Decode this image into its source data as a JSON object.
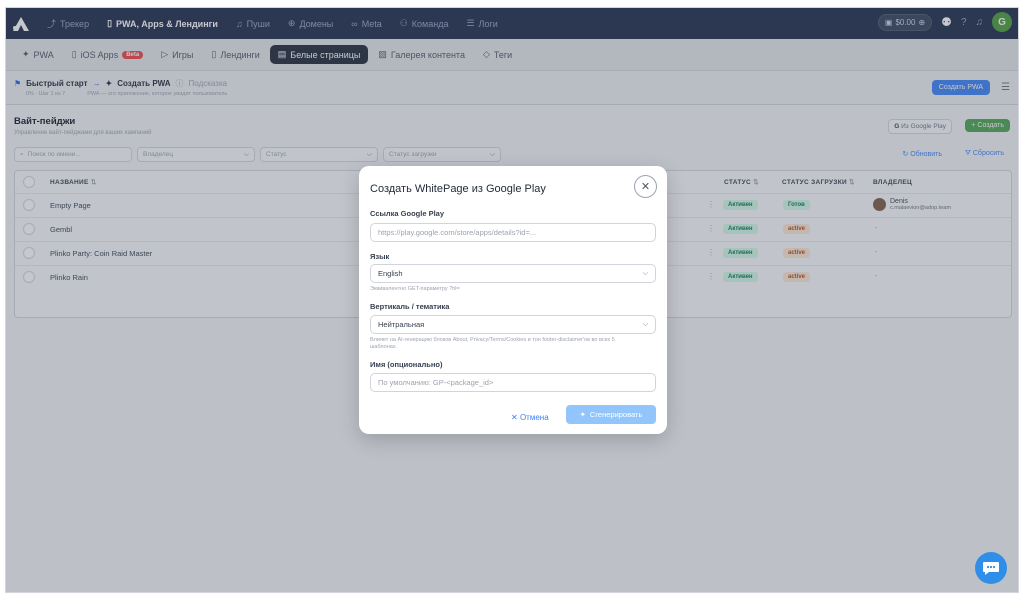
{
  "topnav": [
    {
      "icon": "⤴",
      "label": "Трекер",
      "active": false
    },
    {
      "icon": "▯",
      "label": "PWA, Apps & Лендинги",
      "active": true
    },
    {
      "icon": "♫",
      "label": "Пуши",
      "active": false
    },
    {
      "icon": "⊕",
      "label": "Домены",
      "active": false
    },
    {
      "icon": "∞",
      "label": "Meta",
      "active": false
    },
    {
      "icon": "⚇",
      "label": "Команда",
      "active": false
    },
    {
      "icon": "☰",
      "label": "Логи",
      "active": false
    }
  ],
  "top_right": {
    "balance": "$0.00",
    "avatar_letter": "G"
  },
  "subnav": [
    {
      "icon": "✦",
      "label": "PWA",
      "active": false
    },
    {
      "icon": "▯",
      "label": "iOS Apps",
      "badge": "Beta",
      "active": false
    },
    {
      "icon": "▷",
      "label": "Игры",
      "active": false
    },
    {
      "icon": "▯",
      "label": "Лендинги",
      "active": false
    },
    {
      "icon": "▤",
      "label": "Белые страницы",
      "active": true
    },
    {
      "icon": "▧",
      "label": "Галерея контента",
      "active": false
    },
    {
      "icon": "◇",
      "label": "Теги",
      "active": false
    }
  ],
  "quickstart": {
    "title": "Быстрый старт",
    "step": "Создать PWA",
    "hint": "Подсказка",
    "progress": "0% · Шаг 1 из 7",
    "desc": "PWA — это приложение, которое увидит пользователь",
    "create_pwa_button": "Создать PWA"
  },
  "page": {
    "title": "Вайт-пейджи",
    "subtitle": "Управление вайт-пейджами для ваших кампаний",
    "from_google_play": "Из Google Play",
    "create": "+ Создать",
    "refresh": "Обновить",
    "reset": "Сбросить"
  },
  "filters": {
    "search": "Поиск по имени...",
    "owner": "Владелец",
    "status": "Статус",
    "load_status": "Статус загрузки"
  },
  "table": {
    "headers": {
      "name": "НАЗВАНИЕ",
      "status": "СТАТУС",
      "load_status": "СТАТУС ЗАГРУЗКИ",
      "owner": "ВЛАДЕЛЕЦ"
    },
    "rows": [
      {
        "name": "Empty Page",
        "status": "Активен",
        "load_status": "Готов",
        "load_kind": "ready",
        "owner_name": "Denis",
        "owner_email": "c.malaevion@adop.team"
      },
      {
        "name": "Gembl",
        "status": "Активен",
        "load_status": "active",
        "load_kind": "warn",
        "owner_name": "-"
      },
      {
        "name": "Plinko Party: Coin Raid Master",
        "status": "Активен",
        "load_status": "active",
        "load_kind": "warn",
        "owner_name": "-"
      },
      {
        "name": "Plinko Rain",
        "status": "Активен",
        "load_status": "active",
        "load_kind": "warn",
        "owner_name": "-"
      }
    ]
  },
  "modal": {
    "title": "Создать WhitePage из Google Play",
    "gp_link_label": "Ссылка Google Play",
    "gp_link_placeholder": "https://play.google.com/store/apps/details?id=...",
    "lang_label": "Язык",
    "lang_value": "English",
    "lang_help": "Эквивалентно GET-параметру ?hl=",
    "vertical_label": "Вертикаль / тематика",
    "vertical_value": "Нейтральная",
    "vertical_help": "Влияет на AI-генерацию блоков About, Privacy/Terms/Cookies и тон footer-disclaimer'ов во всех 5 шаблонах.",
    "name_label": "Имя (опционально)",
    "name_placeholder": "По умолчанию: GP-<package_id>",
    "cancel": "Отмена",
    "generate": "Сгенерировать"
  },
  "colors": {
    "topbar": "#1e2a4a",
    "accent": "#3b82f6",
    "create_green": "#4ca24f"
  }
}
